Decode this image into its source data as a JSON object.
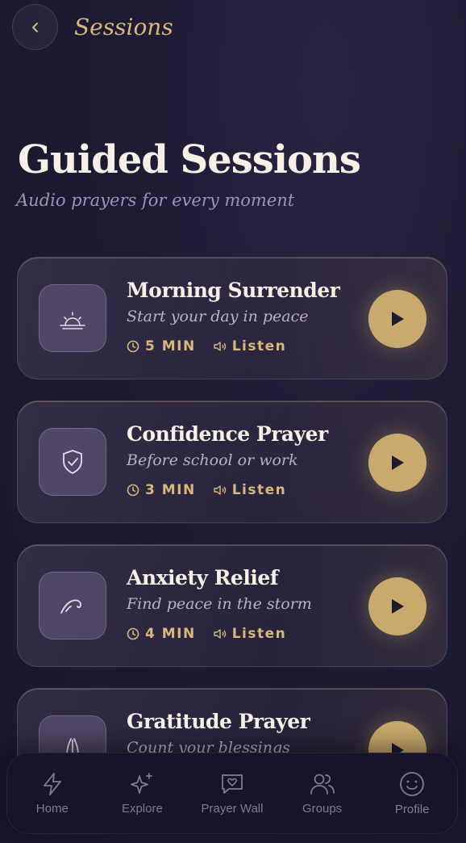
{
  "header": {
    "title": "Sessions"
  },
  "page": {
    "title": "Guided Sessions",
    "subtitle": "Audio prayers for every moment"
  },
  "sessions": [
    {
      "title": "Morning Surrender",
      "description": "Start your day in peace",
      "duration": "5 MIN",
      "action": "Listen",
      "icon": "sunrise-icon"
    },
    {
      "title": "Confidence Prayer",
      "description": "Before school or work",
      "duration": "3 MIN",
      "action": "Listen",
      "icon": "shield-check-icon"
    },
    {
      "title": "Anxiety Relief",
      "description": "Find peace in the storm",
      "duration": "4 MIN",
      "action": "Listen",
      "icon": "wind-icon"
    },
    {
      "title": "Gratitude Prayer",
      "description": "Count your blessings",
      "duration": "",
      "action": "",
      "icon": "praying-hands-icon"
    }
  ],
  "nav": [
    {
      "label": "Home",
      "icon": "lightning-icon"
    },
    {
      "label": "Explore",
      "icon": "sparkles-icon"
    },
    {
      "label": "Prayer Wall",
      "icon": "heart-message-icon"
    },
    {
      "label": "Groups",
      "icon": "users-icon"
    },
    {
      "label": "Profile",
      "icon": "smile-icon"
    }
  ],
  "colors": {
    "accent": "#d8b87a",
    "background": "#1d1a33",
    "play_button": "#c9aa6e"
  }
}
